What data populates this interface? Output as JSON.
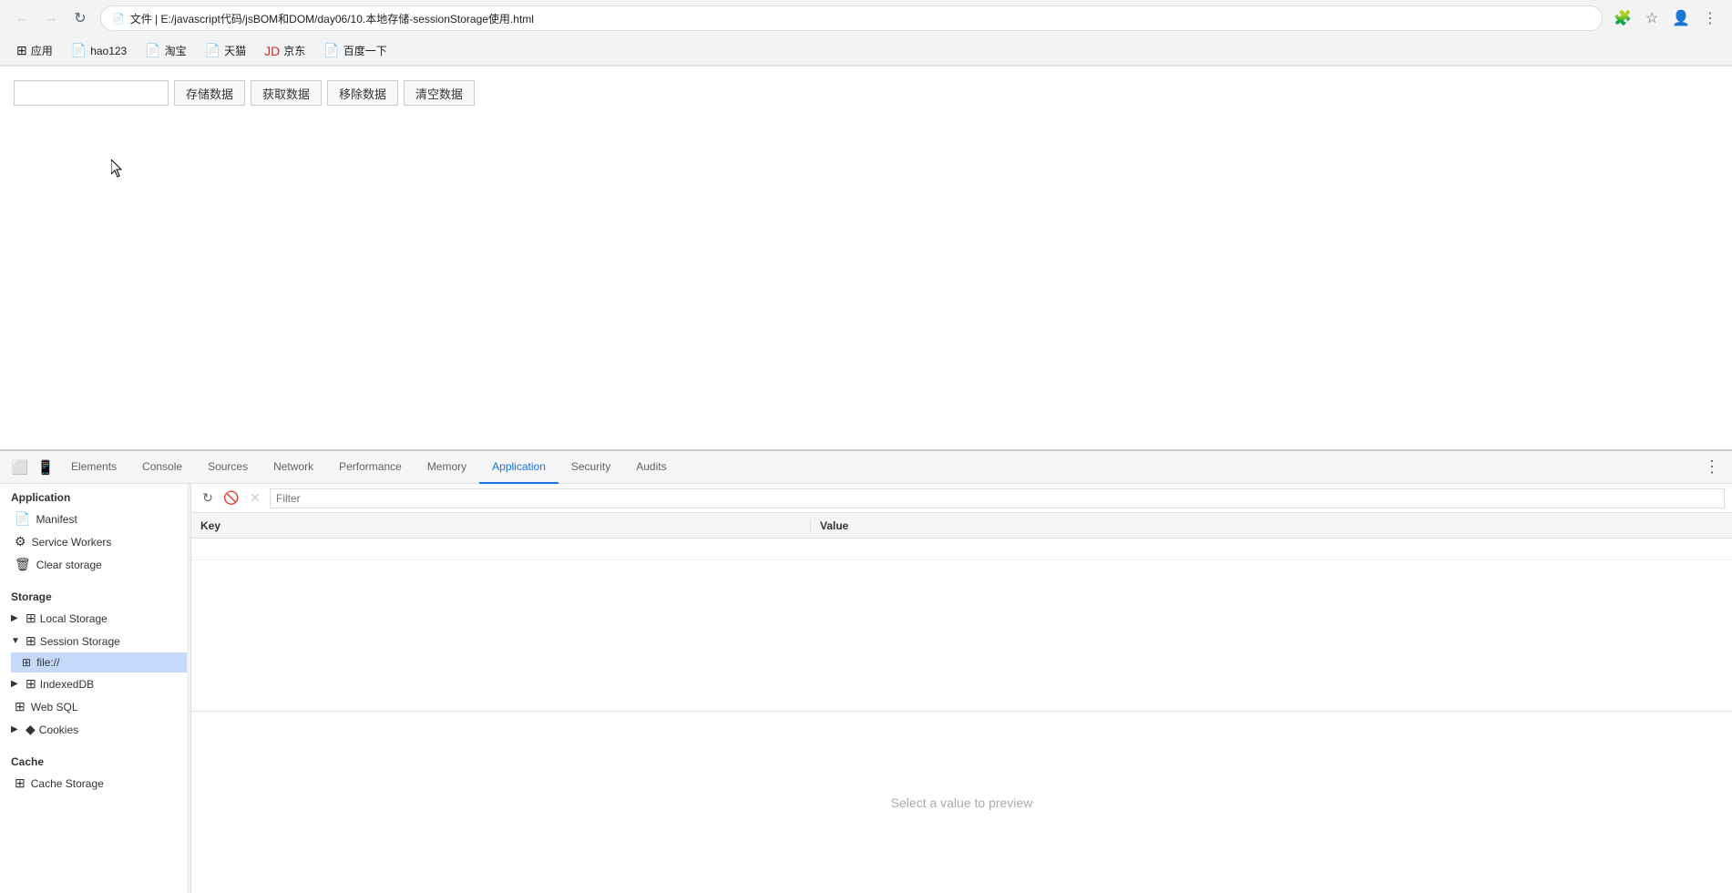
{
  "browser": {
    "title": "文件 | E:/javascript代码/jsBOM和DOM/day06/10.本地存储-sessionStorage使用.html",
    "address": "文件 | E:/javascript代码/jsBOM和DOM/day06/10.本地存储-sessionStorage使用.html",
    "address_icon": "📄"
  },
  "bookmarks": [
    {
      "id": "apps",
      "icon": "⊞",
      "label": "应用"
    },
    {
      "id": "hao123",
      "icon": "📄",
      "label": "hao123"
    },
    {
      "id": "taobao",
      "icon": "📄",
      "label": "淘宝"
    },
    {
      "id": "tmall",
      "icon": "📄",
      "label": "天猫"
    },
    {
      "id": "jd",
      "icon": "🛒",
      "label": "京东"
    },
    {
      "id": "baidu",
      "icon": "📄",
      "label": "百度一下"
    }
  ],
  "page": {
    "input_placeholder": "",
    "btn_store": "存储数据",
    "btn_get": "获取数据",
    "btn_remove": "移除数据",
    "btn_clear": "清空数据"
  },
  "devtools": {
    "tabs": [
      {
        "id": "elements",
        "label": "Elements",
        "active": false
      },
      {
        "id": "console",
        "label": "Console",
        "active": false
      },
      {
        "id": "sources",
        "label": "Sources",
        "active": false
      },
      {
        "id": "network",
        "label": "Network",
        "active": false
      },
      {
        "id": "performance",
        "label": "Performance",
        "active": false
      },
      {
        "id": "memory",
        "label": "Memory",
        "active": false
      },
      {
        "id": "application",
        "label": "Application",
        "active": true
      },
      {
        "id": "security",
        "label": "Security",
        "active": false
      },
      {
        "id": "audits",
        "label": "Audits",
        "active": false
      }
    ],
    "toolbar": {
      "filter_placeholder": "Filter"
    },
    "table": {
      "columns": [
        "Key",
        "Value"
      ]
    },
    "preview": {
      "text": "Select a value to preview"
    },
    "sidebar": {
      "application_section": "Application",
      "items_application": [
        {
          "id": "manifest",
          "icon": "📄",
          "label": "Manifest"
        },
        {
          "id": "service-workers",
          "icon": "⚙",
          "label": "Service Workers"
        },
        {
          "id": "clear-storage",
          "icon": "🗑",
          "label": "Clear storage"
        }
      ],
      "storage_section": "Storage",
      "local_storage": "Local Storage",
      "session_storage": "Session Storage",
      "session_storage_child": "file://",
      "indexed_db": "IndexedDB",
      "web_sql": "Web SQL",
      "cookies": "Cookies",
      "cache_section": "Cache",
      "cache_storage": "Cache Storage"
    }
  }
}
